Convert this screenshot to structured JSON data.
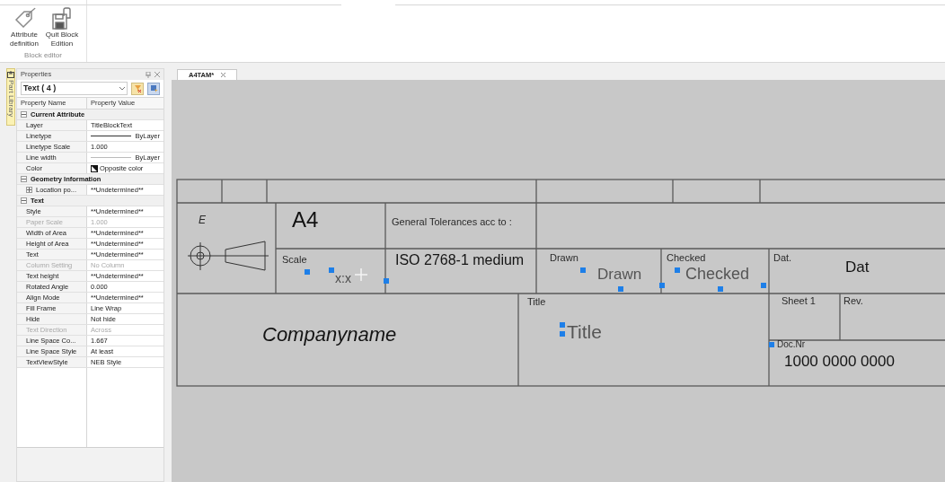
{
  "ribbon": {
    "groups": [
      {
        "label": "Block editor",
        "buttons": [
          {
            "label": "Attribute definition",
            "kind": "tag"
          },
          {
            "label": "Quit Block Edition",
            "kind": "save"
          }
        ]
      }
    ]
  },
  "side_tab": {
    "label": "Part Library"
  },
  "properties": {
    "title": "Properties",
    "selector": "Text ( 4 )",
    "columns": [
      "Property Name",
      "Property Value"
    ],
    "rows": [
      {
        "kind": "group",
        "name": "Current Attribute",
        "expanded": true
      },
      {
        "kind": "prop",
        "name": "Layer",
        "value": "TitleBlockText",
        "disabled": false
      },
      {
        "kind": "line",
        "name": "Linetype",
        "value": "ByLayer",
        "disabled": false
      },
      {
        "kind": "prop",
        "name": "Linetype Scale",
        "value": "1.000",
        "disabled": false
      },
      {
        "kind": "thinline",
        "name": "Line width",
        "value": "ByLayer",
        "disabled": false
      },
      {
        "kind": "color",
        "name": "Color",
        "value": "Opposite color",
        "disabled": false
      },
      {
        "kind": "group",
        "name": "Geometry Information",
        "expanded": true
      },
      {
        "kind": "sub",
        "name": "Location po...",
        "value": "**Undetermined**",
        "expanded": false
      },
      {
        "kind": "group",
        "name": "Text",
        "expanded": true
      },
      {
        "kind": "prop",
        "name": "Style",
        "value": "**Undetermined**",
        "disabled": false
      },
      {
        "kind": "prop",
        "name": "Paper Scale",
        "value": "1.000",
        "disabled": true
      },
      {
        "kind": "prop",
        "name": "Width of Area",
        "value": "**Undetermined**",
        "disabled": false
      },
      {
        "kind": "prop",
        "name": "Height of Area",
        "value": "**Undetermined**",
        "disabled": false
      },
      {
        "kind": "prop",
        "name": "Text",
        "value": "**Undetermined**",
        "disabled": false
      },
      {
        "kind": "prop",
        "name": "Column Setting",
        "value": "No Column",
        "disabled": true
      },
      {
        "kind": "prop",
        "name": "Text height",
        "value": "**Undetermined**",
        "disabled": false
      },
      {
        "kind": "prop",
        "name": "Rotated Angle",
        "value": "0.000",
        "disabled": false
      },
      {
        "kind": "prop",
        "name": "Align Mode",
        "value": "**Undetermined**",
        "disabled": false
      },
      {
        "kind": "prop",
        "name": "Fill Frame",
        "value": "Line Wrap",
        "disabled": false
      },
      {
        "kind": "prop",
        "name": "Hide",
        "value": "Not hide",
        "disabled": false
      },
      {
        "kind": "prop",
        "name": "Text Direction",
        "value": "Across",
        "disabled": true
      },
      {
        "kind": "prop",
        "name": "Line Space Co...",
        "value": "1.667",
        "disabled": false
      },
      {
        "kind": "prop",
        "name": "Line Space Style",
        "value": "At least",
        "disabled": false
      },
      {
        "kind": "prop",
        "name": "TextViewStyle",
        "value": "NEB Style",
        "disabled": false
      }
    ]
  },
  "document_tab": {
    "label": "A4TAM*",
    "selected": true
  },
  "title_block": {
    "texts": [
      {
        "text": "E",
        "kind": "label"
      },
      {
        "text": "A4",
        "kind": "value"
      },
      {
        "text": "General Tolerances acc to :",
        "kind": "label"
      },
      {
        "text": "Scale",
        "kind": "label"
      },
      {
        "text": "x:x",
        "kind": "value"
      },
      {
        "text": "ISO 2768-1 medium",
        "kind": "value"
      },
      {
        "text": "Drawn",
        "kind": "label"
      },
      {
        "text": "Drawn",
        "kind": "value"
      },
      {
        "text": "Checked",
        "kind": "label"
      },
      {
        "text": "Checked",
        "kind": "value"
      },
      {
        "text": "Dat.",
        "kind": "label"
      },
      {
        "text": "Dat",
        "kind": "value"
      },
      {
        "text": "Companyname",
        "kind": "value"
      },
      {
        "text": "Title",
        "kind": "label"
      },
      {
        "text": "Title",
        "kind": "value"
      },
      {
        "text": "Sheet 1",
        "kind": "label"
      },
      {
        "text": "Rev.",
        "kind": "label"
      },
      {
        "text": "Doc.Nr",
        "kind": "label"
      },
      {
        "text": "1000 0000 0000",
        "kind": "value"
      }
    ]
  }
}
